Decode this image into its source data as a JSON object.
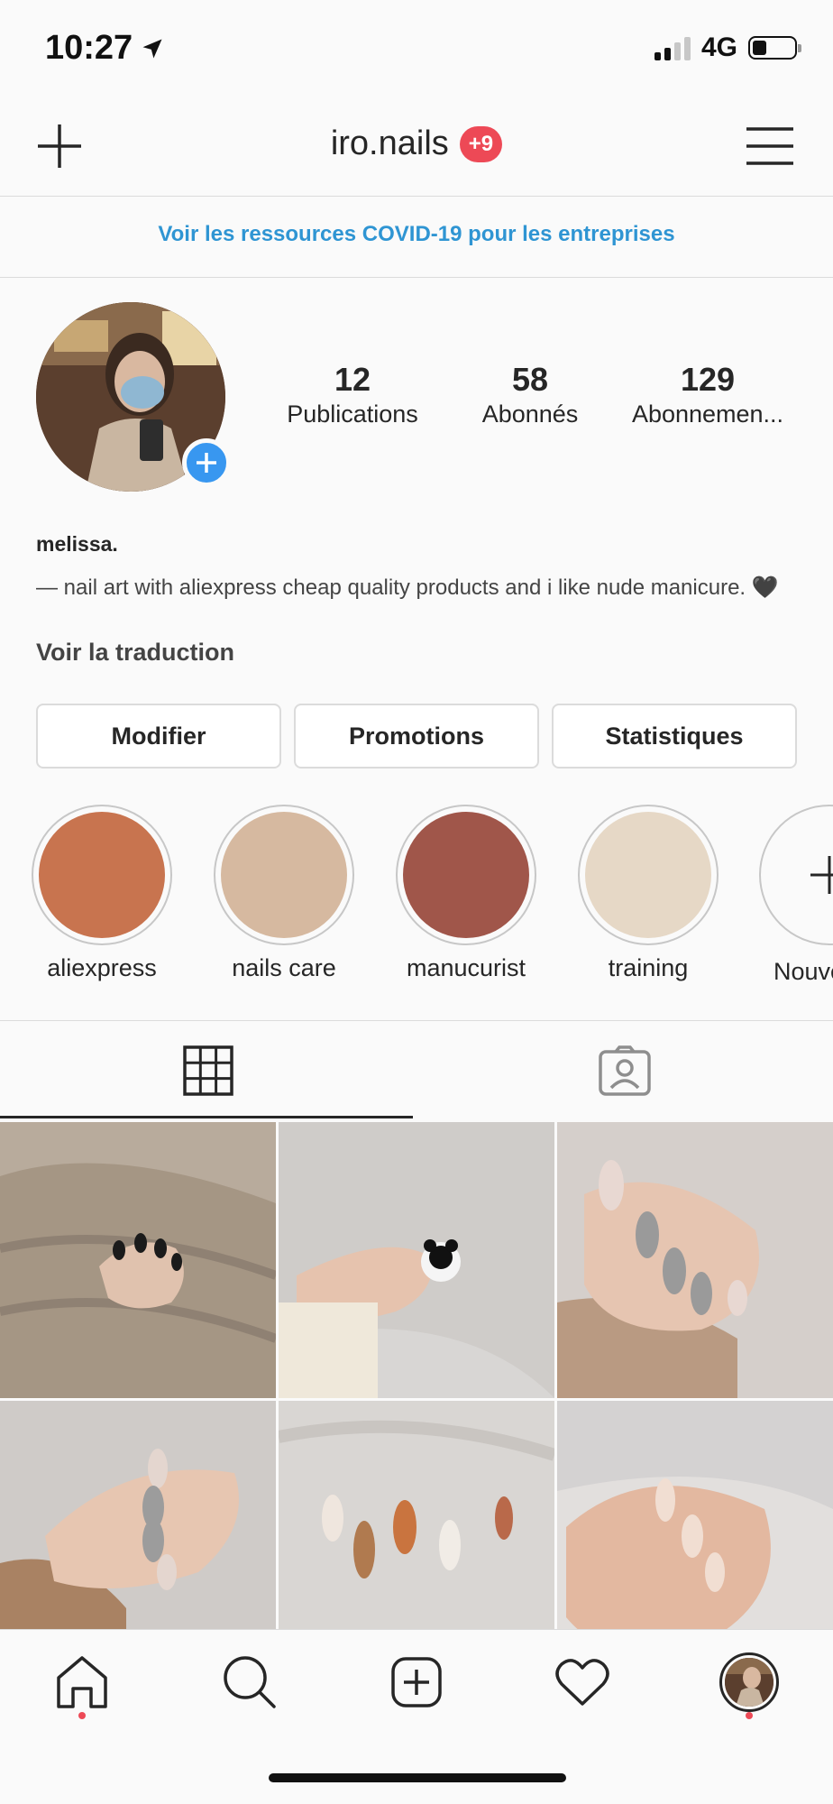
{
  "status_bar": {
    "time": "10:27",
    "network": "4G"
  },
  "header": {
    "username": "iro.nails",
    "notification_badge": "+9"
  },
  "banner": {
    "text": "Voir les ressources COVID-19 pour les entreprises",
    "color": "#2f95d3"
  },
  "profile": {
    "stats": [
      {
        "value": "12",
        "label": "Publications"
      },
      {
        "value": "58",
        "label": "Abonnés"
      },
      {
        "value": "129",
        "label": "Abonnemen..."
      }
    ],
    "name": "melissa.",
    "bio": "— nail art with aliexpress cheap quality products and i like nude manicure. 🖤",
    "translate_link": "Voir la traduction"
  },
  "buttons": {
    "edit": "Modifier",
    "promotions": "Promotions",
    "insights": "Statistiques"
  },
  "highlights": [
    {
      "label": "aliexpress",
      "color": "#c8744f"
    },
    {
      "label": "nails care",
      "color": "#d6b9a0"
    },
    {
      "label": "manucurist",
      "color": "#a0564a"
    },
    {
      "label": "training",
      "color": "#e6d8c6"
    }
  ],
  "new_highlight": {
    "label": "Nouveau"
  },
  "tabs": {
    "active": "grid",
    "items": [
      "grid-icon",
      "tagged-icon"
    ]
  },
  "posts": [
    {
      "alt_colors": [
        "#b8ab9c",
        "#8f8173"
      ]
    },
    {
      "alt_colors": [
        "#d8d6d4",
        "#c6c3c0"
      ]
    },
    {
      "alt_colors": [
        "#d5cfcb",
        "#b99a82"
      ]
    },
    {
      "alt_colors": [
        "#cfcbc8",
        "#a98263"
      ]
    },
    {
      "alt_colors": [
        "#d9d6d3",
        "#c9c5c1"
      ]
    },
    {
      "alt_colors": [
        "#e2dfdd",
        "#d3b39f"
      ]
    }
  ],
  "nav": {
    "items": [
      "home-icon",
      "search-icon",
      "new-post-icon",
      "activity-icon",
      "profile-avatar"
    ]
  }
}
